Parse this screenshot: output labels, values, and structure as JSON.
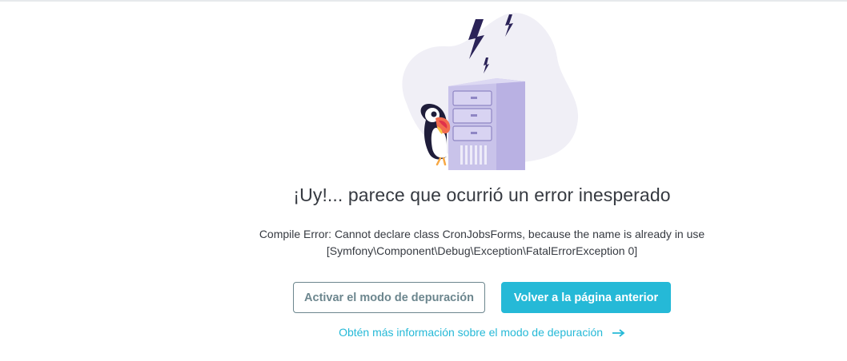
{
  "error_page": {
    "title": "¡Uy!... parece que ocurrió un error inesperado",
    "message_line1": "Compile Error: Cannot declare class CronJobsForms, because the name is already in use",
    "message_line2": "[Symfony\\Component\\Debug\\Exception\\FatalErrorException 0]",
    "debug_button_label": "Activar el modo de depuración",
    "back_button_label": "Volver a la página anterior",
    "learn_more_link": "Obtén más información sobre el modo de depuración"
  },
  "icons": {
    "illustration": "server-error-illustration",
    "link_arrow": "arrow-right-icon"
  },
  "colors": {
    "primary": "#25b9d7",
    "outline": "#6c868e",
    "text": "#363a41",
    "blob": "#f0eff6",
    "server": "#c5bfe9"
  }
}
